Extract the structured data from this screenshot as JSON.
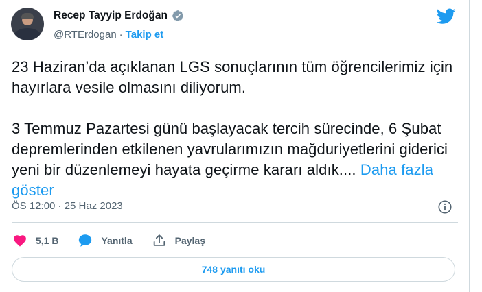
{
  "author": {
    "name": "Recep Tayyip Erdoğan",
    "handle": "@RTErdogan",
    "separator": "·",
    "follow_label": "Takip et"
  },
  "tweet": {
    "paragraph_1": "23 Haziran’da açıklanan LGS sonuçlarının tüm öğrencilerimiz için hayırlara vesile olmasını diliyorum.",
    "paragraph_2": "3 Temmuz Pazartesi günü başlayacak tercih sürecinde, 6 Şubat depremlerinden etkilenen yavrularımızın mağduriyetlerini giderici yeni bir düzenlemeyi hayata geçirme kararı aldık....",
    "show_more": "Daha fazla göster"
  },
  "meta": {
    "timestamp": "ÖS 12:00 · 25 Haz 2023"
  },
  "actions": {
    "like_count": "5,1 B",
    "reply_label": "Yanıtla",
    "share_label": "Paylaş"
  },
  "replies_button": "748 yanıtı oku",
  "colors": {
    "accent": "#1d9bf0",
    "like": "#f91880",
    "secondary_text": "#536471",
    "border": "#cfd9de"
  },
  "icons": [
    "verified-badge-icon",
    "twitter-bird-icon",
    "info-icon",
    "heart-icon",
    "reply-bubble-icon",
    "share-icon"
  ]
}
